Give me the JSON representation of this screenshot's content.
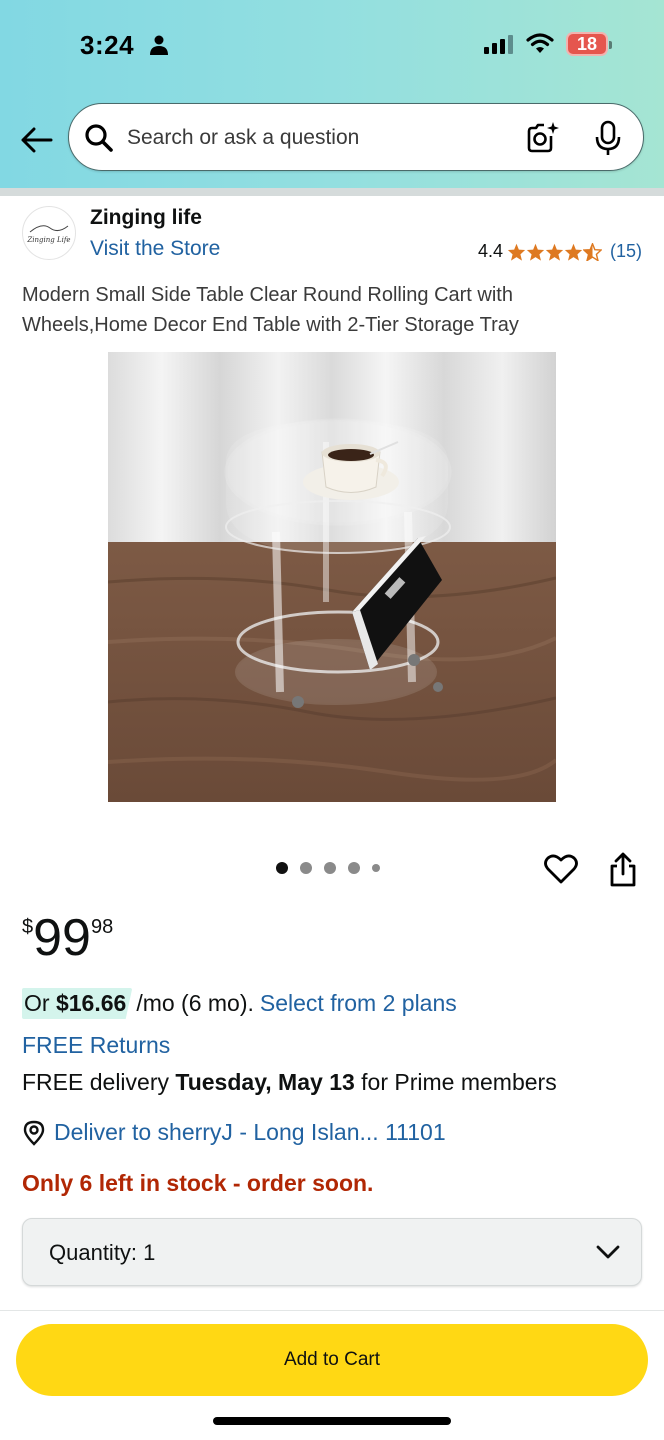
{
  "status_bar": {
    "time": "3:24",
    "battery": "18",
    "battery_color": "#e5564e"
  },
  "search": {
    "placeholder": "Search or ask a question"
  },
  "store": {
    "logo_text": "Zinging Life",
    "name": "Zinging life",
    "visit_label": "Visit the Store",
    "rating_value": "4.4",
    "rating_stars": 4.4,
    "rating_count": "(15)"
  },
  "product": {
    "title": "Modern Small Side Table Clear Round Rolling Cart with Wheels,Home Decor End Table with 2-Tier Storage Tray",
    "image_count": 5,
    "active_image": 1
  },
  "price": {
    "symbol": "$",
    "whole": "99",
    "fraction": "98"
  },
  "monthly": {
    "or_label": "Or",
    "amount": "$16.66",
    "term": "/mo (6 mo).",
    "plans_link": "Select from 2 plans"
  },
  "shipping": {
    "free_returns": "FREE Returns",
    "delivery_prefix": "FREE delivery",
    "delivery_date": "Tuesday, May 13",
    "delivery_suffix": "for Prime members",
    "deliver_to": "Deliver to sherryJ - Long Islan... 11101"
  },
  "stock": {
    "message": "Only 6 left in stock - order soon."
  },
  "quantity": {
    "label": "Quantity:",
    "value": "1"
  },
  "cart": {
    "button_label": "Add to Cart",
    "button_color": "#ffd814"
  },
  "colors": {
    "link": "#2162a1",
    "stock_red": "#b12704",
    "star": "#de7921"
  }
}
